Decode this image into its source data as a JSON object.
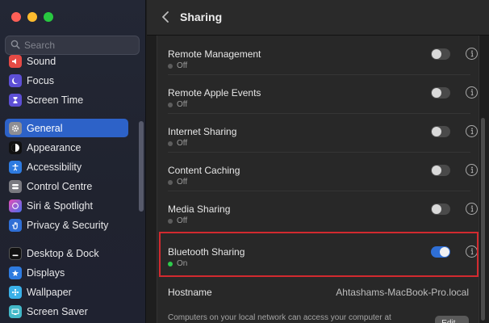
{
  "window": {
    "title": "Sharing"
  },
  "colors": {
    "accent": "#2d62c8",
    "toggle_on": "#2f6fd6",
    "status_on": "#2ecb4c",
    "highlight": "#d22a2f"
  },
  "search": {
    "placeholder": "Search"
  },
  "sidebar": {
    "items": [
      {
        "label": "Sound",
        "icon": "speaker-icon"
      },
      {
        "label": "Focus",
        "icon": "moon-icon"
      },
      {
        "label": "Screen Time",
        "icon": "hourglass-icon"
      },
      {
        "label": "General",
        "icon": "gear-icon",
        "selected": true
      },
      {
        "label": "Appearance",
        "icon": "appearance-icon"
      },
      {
        "label": "Accessibility",
        "icon": "accessibility-icon"
      },
      {
        "label": "Control Centre",
        "icon": "control-centre-icon"
      },
      {
        "label": "Siri & Spotlight",
        "icon": "siri-icon"
      },
      {
        "label": "Privacy & Security",
        "icon": "hand-icon"
      },
      {
        "label": "Desktop & Dock",
        "icon": "dock-icon"
      },
      {
        "label": "Displays",
        "icon": "display-icon"
      },
      {
        "label": "Wallpaper",
        "icon": "wallpaper-icon"
      },
      {
        "label": "Screen Saver",
        "icon": "screensaver-icon"
      }
    ]
  },
  "services": [
    {
      "name": "Remote Management",
      "status": "Off",
      "enabled": false
    },
    {
      "name": "Remote Apple Events",
      "status": "Off",
      "enabled": false
    },
    {
      "name": "Internet Sharing",
      "status": "Off",
      "enabled": false
    },
    {
      "name": "Content Caching",
      "status": "Off",
      "enabled": false
    },
    {
      "name": "Media Sharing",
      "status": "Off",
      "enabled": false
    },
    {
      "name": "Bluetooth Sharing",
      "status": "On",
      "enabled": true
    }
  ],
  "hostname": {
    "label": "Hostname",
    "value": "Ahtashams-MacBook-Pro.local"
  },
  "description": "Computers on your local network can access your computer at",
  "edit_label": "Edit..."
}
